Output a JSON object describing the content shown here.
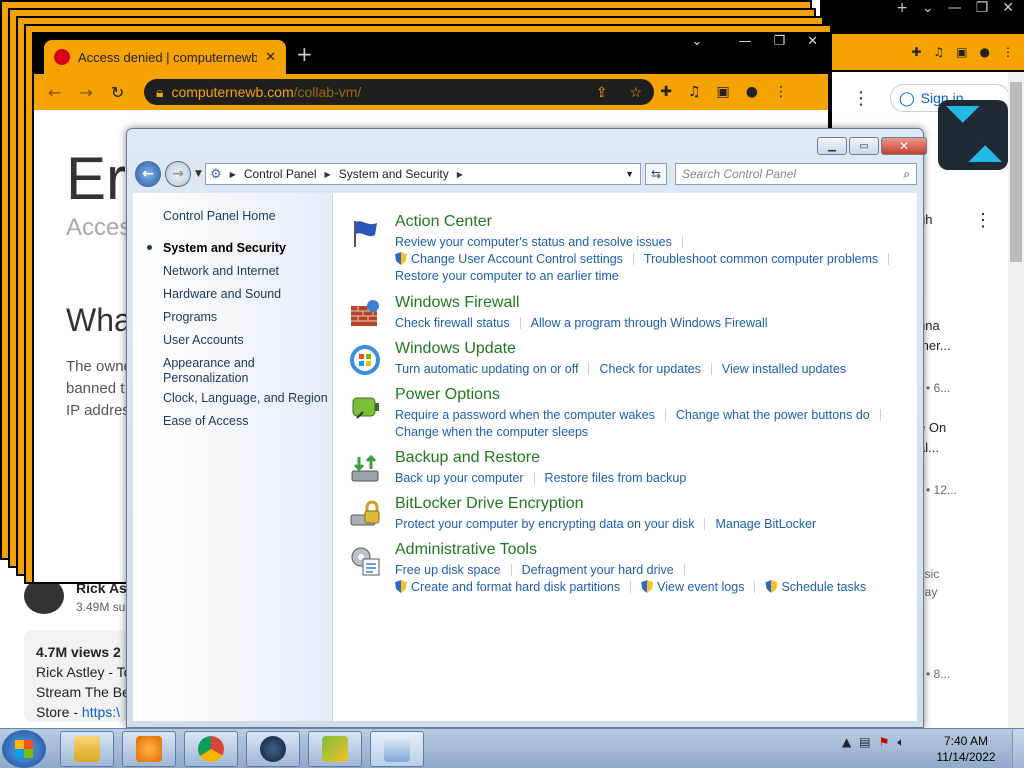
{
  "back_browser": {
    "sign_in": "Sign in",
    "right_column": [
      {
        "text": "gh",
        "y": 0
      },
      {
        "text": "nna",
        "y": 0
      },
      {
        "text": "ther...",
        "y": 0
      },
      {
        "text": "e",
        "y": 0
      },
      {
        "text": "• 6...",
        "y": 0
      },
      {
        "text": "e On",
        "y": 0
      },
      {
        "text": "al...",
        "y": 0
      },
      {
        "text": "e",
        "y": 0
      },
      {
        "text": "• 12...",
        "y": 0
      },
      {
        "text": "usic",
        "y": 0
      },
      {
        "text": "day",
        "y": 0
      },
      {
        "text": "e",
        "y": 0
      },
      {
        "text": "• 8...",
        "y": 0
      }
    ],
    "channel_name": "Rick As",
    "subscribers": "3.49M su",
    "description": {
      "views": "4.7M views  2",
      "line1": "Rick Astley - To",
      "line2": "Stream The Be",
      "line3_prefix": "Store - ",
      "line3_link": "https:\\"
    }
  },
  "front_browser": {
    "tab_title": "Access denied | computernewb.c",
    "url_host": "computernewb.com",
    "url_path": "/collab-vm/",
    "error_title": "Err",
    "error_subtitle": "Acces",
    "error_question": "Wha",
    "error_body_1": "The owne",
    "error_body_2": "banned t",
    "error_body_3": "IP addres"
  },
  "control_panel": {
    "breadcrumb": [
      "Control Panel",
      "System and Security"
    ],
    "search_placeholder": "Search Control Panel",
    "left_nav": [
      "Control Panel Home",
      "System and Security",
      "Network and Internet",
      "Hardware and Sound",
      "Programs",
      "User Accounts",
      "Appearance and Personalization",
      "Clock, Language, and Region",
      "Ease of Access"
    ],
    "categories": [
      {
        "title": "Action Center",
        "icon": "flag-icon",
        "links": [
          "Review your computer's status and resolve issues",
          "Change User Account Control settings",
          "Troubleshoot common computer problems",
          "Restore your computer to an earlier time"
        ]
      },
      {
        "title": "Windows Firewall",
        "icon": "firewall-icon",
        "links": [
          "Check firewall status",
          "Allow a program through Windows Firewall"
        ]
      },
      {
        "title": "Windows Update",
        "icon": "windows-update-icon",
        "links": [
          "Turn automatic updating on or off",
          "Check for updates",
          "View installed updates"
        ]
      },
      {
        "title": "Power Options",
        "icon": "power-options-icon",
        "links": [
          "Require a password when the computer wakes",
          "Change what the power buttons do",
          "Change when the computer sleeps"
        ]
      },
      {
        "title": "Backup and Restore",
        "icon": "backup-icon",
        "links": [
          "Back up your computer",
          "Restore files from backup"
        ]
      },
      {
        "title": "BitLocker Drive Encryption",
        "icon": "bitlocker-icon",
        "links": [
          "Protect your computer by encrypting data on your disk",
          "Manage BitLocker"
        ]
      },
      {
        "title": "Administrative Tools",
        "icon": "admin-tools-icon",
        "links": [
          "Free up disk space",
          "Defragment your hard drive",
          "Create and format hard disk partitions",
          "View event logs",
          "Schedule tasks"
        ]
      }
    ]
  },
  "taskbar": {
    "time": "7:40 AM",
    "date": "11/14/2022"
  }
}
